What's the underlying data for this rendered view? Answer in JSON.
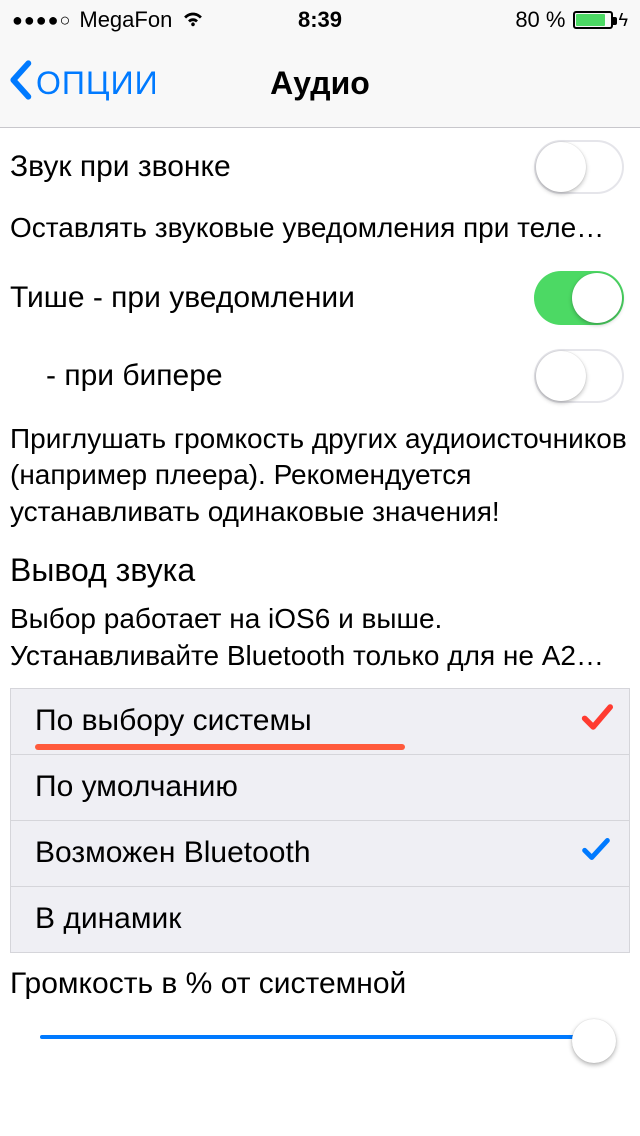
{
  "status": {
    "signal_dots": "●●●●○",
    "carrier": "MegaFon",
    "time": "8:39",
    "battery_text": "80 %",
    "battery_pct": 80
  },
  "nav": {
    "back_label": "ОПЦИИ",
    "title": "Аудио"
  },
  "rows": {
    "sound_on_call": {
      "label": "Звук при звонке",
      "on": false
    },
    "sound_on_call_note": "Оставлять звуковые уведомления при теле…",
    "quiet_on_notify": {
      "label": "Тише - при уведомлении",
      "on": true
    },
    "quiet_on_beeper": {
      "label": " - при бипере",
      "on": false
    },
    "quiet_note": "Приглушать громкость других аудиоисточников (например плеера). Рекомендуется устанавливать одинаковые значения!",
    "output_title": "Вывод звука",
    "output_note_l1": "Выбор работает на iOS6 и выше.",
    "output_note_l2": "Устанавливайте Bluetooth только для не A2…"
  },
  "output_options": [
    {
      "label": "По выбору системы",
      "checked": false,
      "highlighted": true,
      "red_mark": true
    },
    {
      "label": "По умолчанию",
      "checked": false
    },
    {
      "label": "Возможен Bluetooth",
      "checked": true
    },
    {
      "label": "В динамик",
      "checked": false
    }
  ],
  "volume": {
    "title": "Громкость в % от системной",
    "value_pct": 98
  },
  "colors": {
    "tint": "#007aff",
    "green": "#4cd964",
    "highlight": "#ff5a3c"
  }
}
